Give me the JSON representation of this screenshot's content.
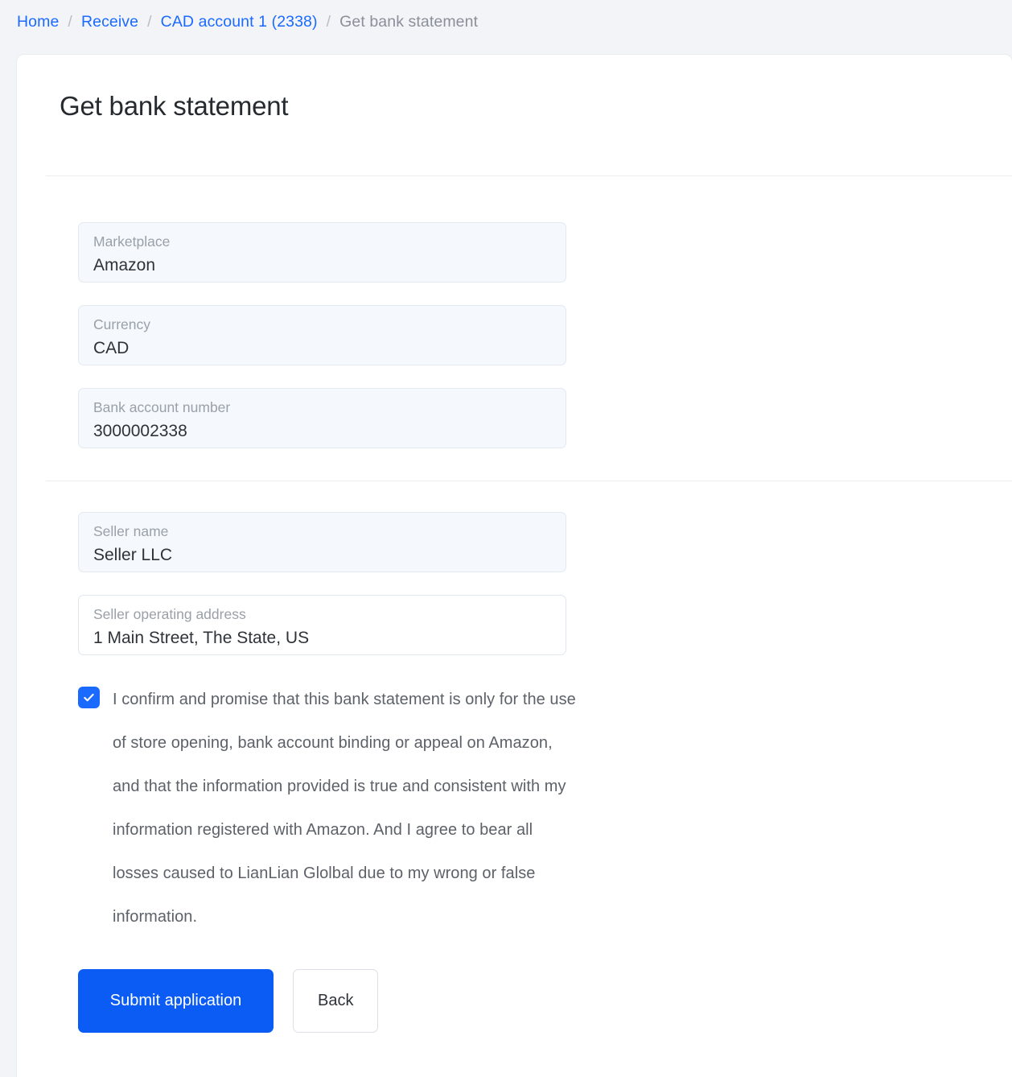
{
  "breadcrumb": {
    "separator": "/",
    "items": [
      {
        "label": "Home",
        "type": "link"
      },
      {
        "label": "Receive",
        "type": "link"
      },
      {
        "label": "CAD account 1 (2338)",
        "type": "link"
      },
      {
        "label": "Get bank statement",
        "type": "current"
      }
    ]
  },
  "page": {
    "title": "Get bank statement"
  },
  "form": {
    "account_section": [
      {
        "label": "Marketplace",
        "value": "Amazon",
        "readonly": true
      },
      {
        "label": "Currency",
        "value": "CAD",
        "readonly": true
      },
      {
        "label": "Bank account number",
        "value": "3000002338",
        "readonly": true
      }
    ],
    "seller_section": [
      {
        "label": "Seller name",
        "value": "Seller LLC",
        "readonly": true
      },
      {
        "label": "Seller operating address",
        "value": "1 Main Street, The State, US",
        "readonly": false
      }
    ]
  },
  "consent": {
    "checked": true,
    "checkbox_icon": "check-icon",
    "text": "I confirm and promise that this bank statement is only for the use of store opening, bank account binding or appeal on Amazon, and that the information provided is true and consistent with my information registered with Amazon. And I agree to bear all losses caused to LianLian Glolbal due to my wrong or false information."
  },
  "actions": {
    "submit_label": "Submit application",
    "back_label": "Back"
  },
  "colors": {
    "accent_blue": "#0b5cf5",
    "link_blue": "#1a6aff",
    "page_background": "#f2f4f7",
    "readonly_field_background": "#f5f9fd"
  }
}
